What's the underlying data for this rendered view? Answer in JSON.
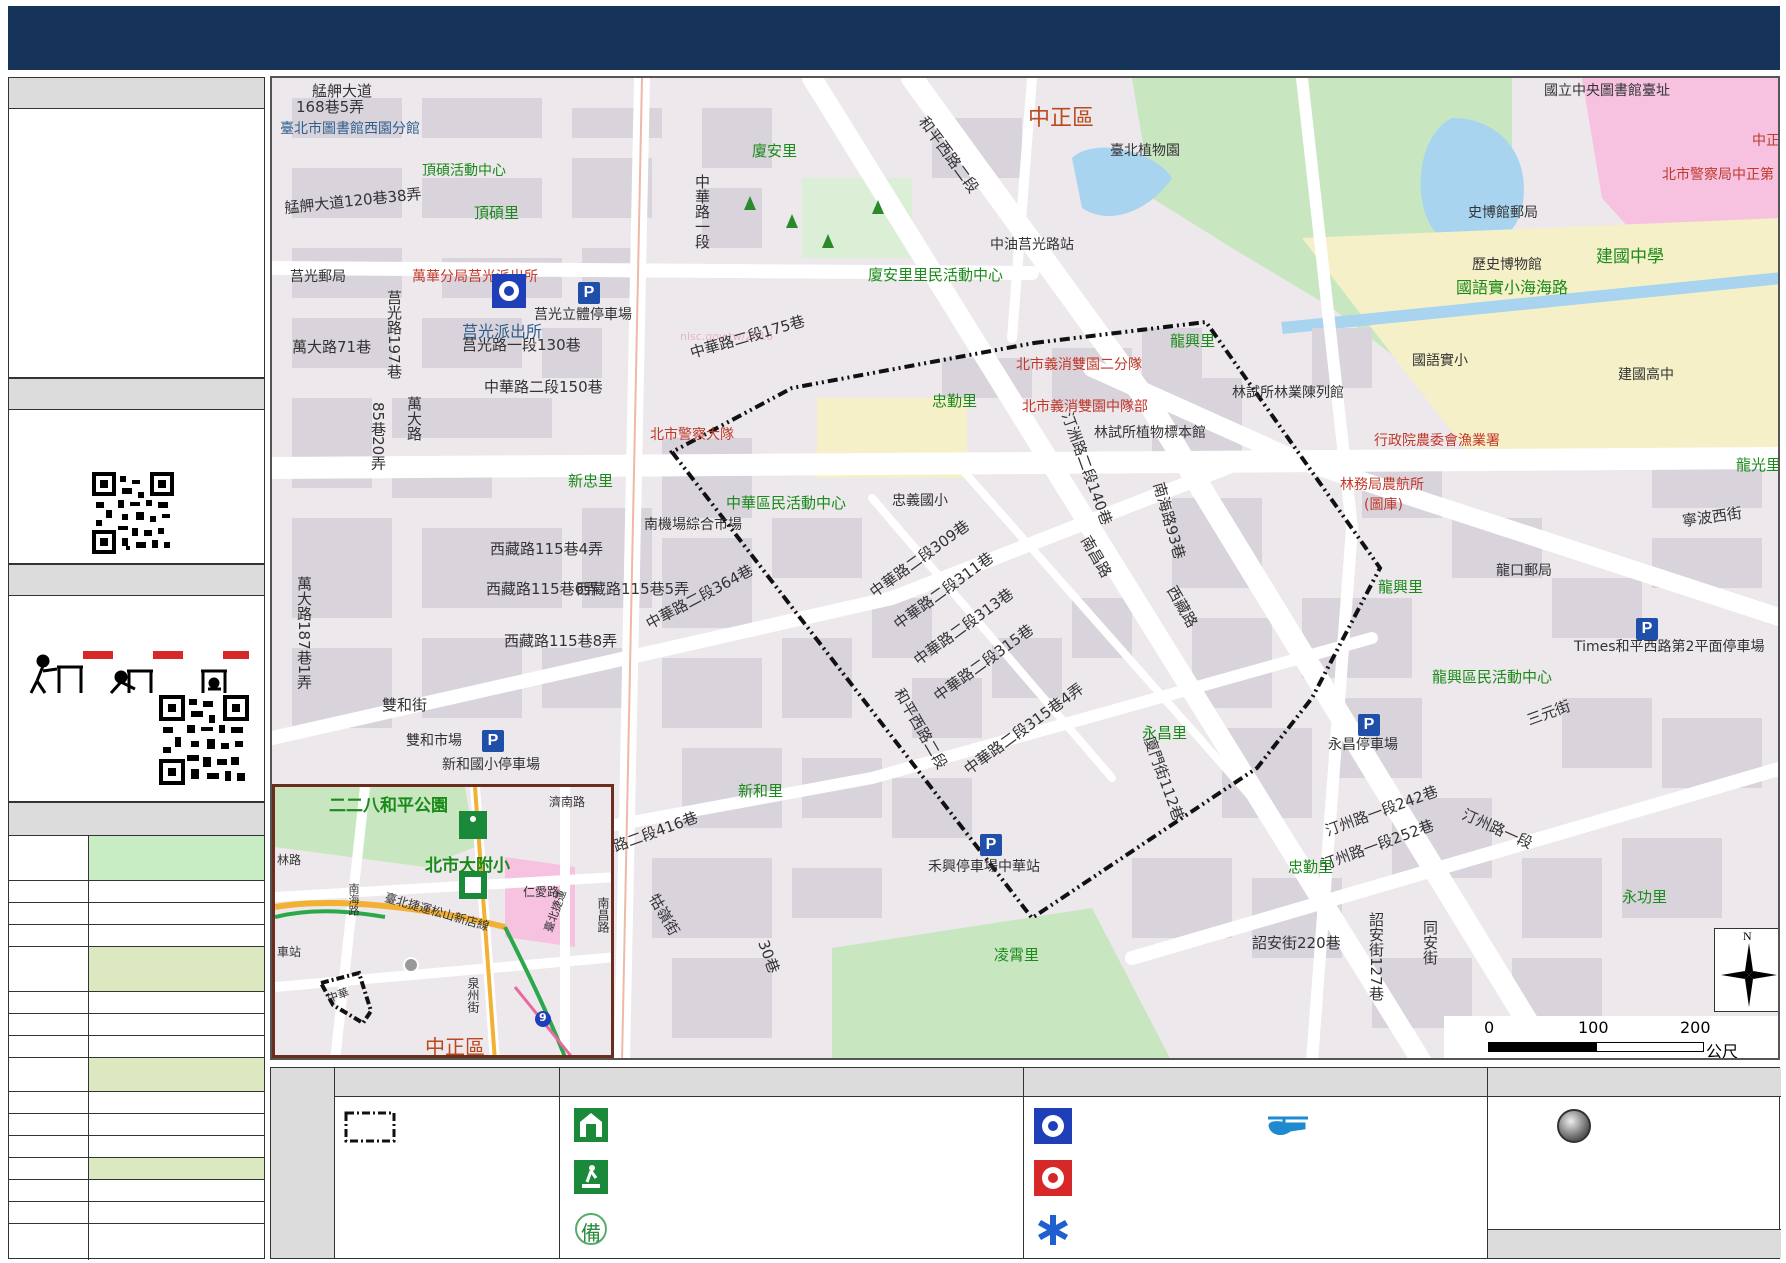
{
  "map": {
    "district_labels": [
      "中正區"
    ],
    "village_labels": [
      "廈安里",
      "頂碩里",
      "忠勤里",
      "新忠里",
      "龍興里",
      "龍光里",
      "永昌里",
      "新和里",
      "凌霄里",
      "永功里",
      "龍興里"
    ],
    "place_labels": {
      "library": "臺北市圖書館西園分館",
      "dingshuo_center": "頂碩活動中心",
      "post_guangguang": "莒光郵局",
      "wanhua_police": "萬華分局莒光派出所",
      "juguang_police": "莒光派出所",
      "juguang_parking": "莒光立體停車場",
      "xiaan_center": "廈安里里民活動中心",
      "cpc_station": "中油莒光路站",
      "botanical": "臺北植物園",
      "history_museum_post": "史博館郵局",
      "history_museum": "歷史博物館",
      "jianguo_hs": "建國中學",
      "mandarin_school": "國語實小海海路",
      "guoyu": "國語實小",
      "jianguo_hs2": "建國高中",
      "fire_2nd": "北市義消雙園二分隊",
      "fire_mid": "北市義消雙園中隊部",
      "forestry_exhibit": "林試所林業陳列館",
      "plant_specimen": "林試所植物標本館",
      "fishery": "行政院農委會漁業署",
      "forest_bureau": "林務局農航所",
      "forest_bureau_sub": "(圖庫)",
      "police_brigade": "北市警察大隊",
      "zhonghua_center": "中華區民活動中心",
      "zhongyi_school": "忠義國小",
      "nanjichang_market": "南機場綜合市場",
      "longkou_post": "龍口郵局",
      "times_parking": "Times和平西路第2平面停車場",
      "longxing_center": "龍興區民活動中心",
      "yongchang_parking": "永昌停車場",
      "shuanghe_market": "雙和市場",
      "xinhe_parking": "新和國小停車場",
      "heping_parking": "禾興停車場中華站",
      "library_central": "國立中央圖書館臺址",
      "police_zhongzheng": "北市警察局中正第",
      "zheng1": "中正"
    },
    "road_labels": [
      "艋舺大道",
      "168巷5弄",
      "艋舺大道120巷38弄",
      "萬大路71巷",
      "莒光路197巷",
      "莒光路一段130巷",
      "中華路二段150巷",
      "85巷20弄",
      "萬大路",
      "中華路二段175巷",
      "和平西路二段",
      "萬大路187巷1弄",
      "西藏路115巷4弄",
      "西藏路115巷6弄",
      "西藏路115巷5弄",
      "西藏路115巷8弄",
      "中華路二段364巷",
      "中華路二段309巷",
      "中華路二段311巷",
      "中華路二段313巷",
      "中華路二段315巷",
      "中華路二段315巷4弄",
      "汀洲路二段140巷",
      "南海路93巷",
      "南昌路",
      "雙和街",
      "中華路二段416巷",
      "和平西路二段",
      "牯嶺街",
      "廈門街112巷",
      "汀州路一段242巷",
      "汀州路一段252巷",
      "汀州路一段",
      "三元街",
      "詔安街220巷",
      "詔安街127巷",
      "同安街",
      "寧波西街",
      "中華路一段",
      "西藏路",
      "30巷"
    ],
    "scale_ticks": [
      "0",
      "100",
      "200"
    ],
    "scale_unit": "公尺",
    "north_label": "N",
    "watermark": "nlsc.gov.tw/2016"
  },
  "inset": {
    "labels": {
      "park": "二二八和平公園",
      "school": "北市大附小",
      "district": "中正區",
      "mrt": "臺北捷運松山新店線",
      "street1": "泉州街",
      "street2": "仁愛路",
      "street3": "濟南路",
      "street4": "南昌路",
      "road_left": "林路",
      "station": "車站",
      "road_h": "中華",
      "road_v": "南海路",
      "mrt2": "臺北捷運",
      "exit": "9"
    }
  },
  "legend": {
    "icons": {
      "area": "dashed-boundary-icon",
      "shelter": "evacuation-shelter-icon",
      "refuge": "refuge-area-icon",
      "backup": "backup-shelter-icon",
      "police": "police-icon",
      "fire": "fire-dept-icon",
      "medical": "medical-icon",
      "helipad": "helicopter-icon",
      "other": "gray-circle-icon"
    },
    "backup_glyph": "備"
  },
  "colors": {
    "title_bar": "#163459",
    "panel_head": "#dcdcdc",
    "table_green": "#c8ecc4",
    "table_olive": "#dce8c0",
    "map_bg": "#ece8ec",
    "block": "#d9d3dc",
    "park": "#c8e6c0",
    "water": "#a8d4f0",
    "pink": "#f6c2e0",
    "yellow": "#f5f0c8"
  }
}
